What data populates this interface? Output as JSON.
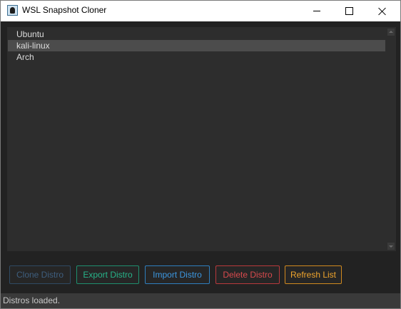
{
  "window": {
    "title": "WSL Snapshot Cloner",
    "app_icon": "penguin-icon",
    "controls": {
      "minimize": "minimize-icon",
      "maximize": "maximize-icon",
      "close": "close-icon"
    }
  },
  "distro_list": {
    "items": [
      {
        "label": "Ubuntu",
        "selected": false
      },
      {
        "label": "kali-linux",
        "selected": true
      },
      {
        "label": "Arch",
        "selected": false
      }
    ]
  },
  "buttons": {
    "clone": {
      "label": "Clone Distro",
      "enabled": false,
      "color": "#3e5e7e"
    },
    "export": {
      "label": "Export Distro",
      "enabled": true,
      "color": "#27b389"
    },
    "import": {
      "label": "Import Distro",
      "enabled": true,
      "color": "#3c97e0"
    },
    "delete": {
      "label": "Delete Distro",
      "enabled": true,
      "color": "#d84a4d"
    },
    "refresh": {
      "label": "Refresh List",
      "enabled": true,
      "color": "#f0a52d"
    }
  },
  "status": {
    "text": "Distros loaded."
  },
  "colors": {
    "background": "#222222",
    "list_background": "#2d2d2d",
    "selection": "#4c4c4c",
    "statusbar": "#3a3a3a"
  }
}
